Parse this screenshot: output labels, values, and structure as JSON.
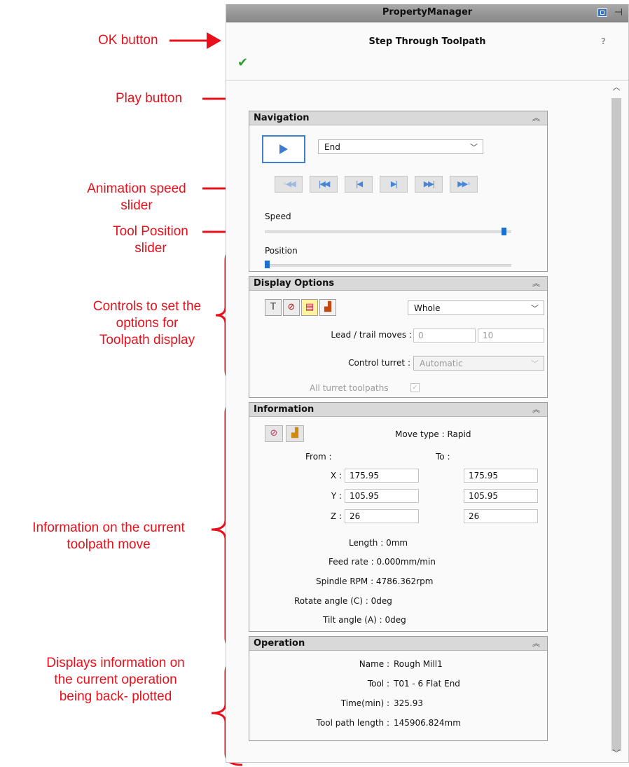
{
  "annotations": {
    "ok_button": "OK button",
    "play_button": "Play button",
    "animation_speed_slider": [
      "Animation speed",
      "slider"
    ],
    "tool_position_slider": [
      "Tool Position",
      "slider"
    ],
    "display_controls": [
      "Controls to set the",
      "options for",
      "Toolpath display"
    ],
    "information": [
      "Information on the current",
      "toolpath move"
    ],
    "operation": [
      "Displays information on",
      "the current operation",
      "being back- plotted"
    ]
  },
  "window": {
    "title": "PropertyManager",
    "feature_title": "Step Through Toolpath",
    "help_glyph": "?",
    "ok_glyph": "✔"
  },
  "navigation": {
    "header": "Navigation",
    "mode": "End",
    "speed_label": "Speed",
    "position_label": "Position",
    "speed_level": 0.98,
    "position_level": 0.0,
    "buttons": [
      "◦◀◀",
      "|◀◀",
      "|◀",
      "▶|",
      "▶▶|",
      "▶▶◦"
    ]
  },
  "display_options": {
    "header": "Display Options",
    "display_mode": "Whole",
    "lead_trail_label": "Lead / trail moves :",
    "lead_value": "0",
    "trail_value": "10",
    "control_turret_label": "Control turret :",
    "control_turret_value": "Automatic",
    "all_turret_label": "All turret toolpaths"
  },
  "information": {
    "header": "Information",
    "move_type": "Move type : Rapid",
    "from_label": "From :",
    "to_label": "To :",
    "coords": [
      {
        "axis": "X :",
        "from": "175.95",
        "to": "175.95"
      },
      {
        "axis": "Y :",
        "from": "105.95",
        "to": "105.95"
      },
      {
        "axis": "Z :",
        "from": "26",
        "to": "26"
      }
    ],
    "length": "Length : 0mm",
    "feed_rate": "Feed rate : 0.000mm/min",
    "spindle": "Spindle RPM : 4786.362rpm",
    "rotate": "Rotate angle (C) : 0deg",
    "tilt": "Tilt angle (A) : 0deg"
  },
  "operation": {
    "header": "Operation",
    "rows": [
      {
        "label": "Name :",
        "value": "Rough Mill1"
      },
      {
        "label": "Tool :",
        "value": "T01 - 6 Flat End"
      },
      {
        "label": "Time(min) :",
        "value": "325.93"
      },
      {
        "label": "Tool path length :",
        "value": "145906.824mm"
      }
    ]
  },
  "colors": {
    "annotation": "#e8111b",
    "accent": "#3c7bd0",
    "ok": "#2f9e2f"
  }
}
